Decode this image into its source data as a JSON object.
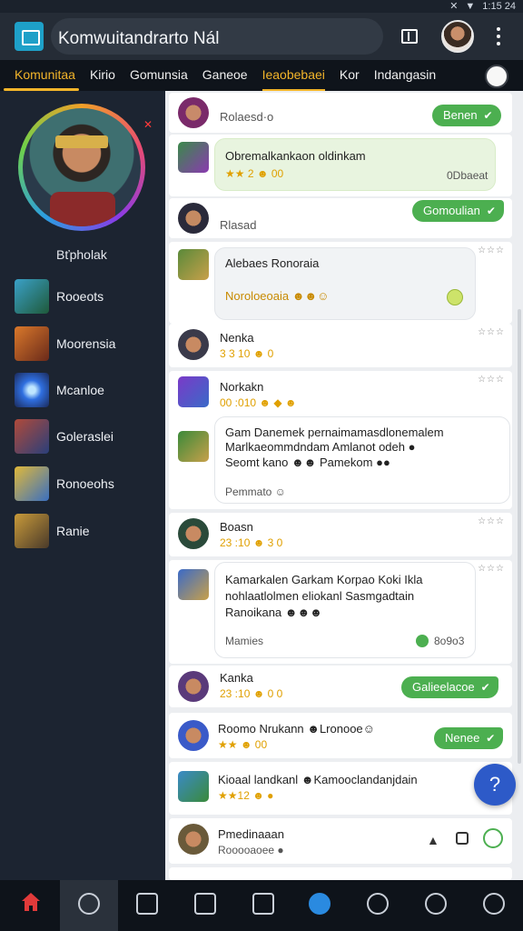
{
  "status_bar": {
    "time": "1:15 24"
  },
  "app_bar": {
    "title": "Komwuitandrarto Nál"
  },
  "tabs": [
    "Komunitaa",
    "Kirio",
    "Gomunsia",
    "Ganeoe",
    "Ieaobebaei",
    "Kor",
    "Indangasin"
  ],
  "sidebar": {
    "hero_name": "Bťpholak",
    "items": [
      {
        "label": "Rooeots",
        "color": "#3aa0c8"
      },
      {
        "label": "Moorensia",
        "color": "#d9782b"
      },
      {
        "label": "Mcanloe",
        "color": "#2f6fe0"
      },
      {
        "label": "Goleraslei",
        "color": "#b04a3a"
      },
      {
        "label": "Ronoeohs",
        "color": "#e0b83a"
      },
      {
        "label": "Ranie",
        "color": "#c89a3a"
      }
    ]
  },
  "feed": {
    "post1": {
      "name": "Rolaesd·o",
      "badge": "Benen"
    },
    "post2": {
      "text": "Obremalkankaon oldinkam",
      "meta": "★★ 2 ☻ 00",
      "right": "0Dbaeat"
    },
    "post3": {
      "name": "Rlasad",
      "badge": "Gomoulian"
    },
    "post4": {
      "title": "Alebaes Ronoraia",
      "sub": "Noroloeoaia ☻☻☺"
    },
    "post5": {
      "name": "Nenka",
      "meta": "3 3 10 ☻ 0"
    },
    "post6": {
      "name": "Norkakn",
      "meta": "00 :010 ☻ ◆ ☻",
      "line1": "Gam Danemek pernaimamasdlonemalem",
      "line2": "Marlkaeommdndam Amlanot odeh ●",
      "line3": "Seomt kano ☻☻ Pamekom ●●",
      "footer": "Pemmato ☺"
    },
    "post7": {
      "name": "Boasn",
      "meta": "23 :10 ☻ 3 0"
    },
    "post8": {
      "line1": "Kamarkalen Garkam Korpao Koki Ikla",
      "line2": "nohlaatlolmen eliokanl Sasmgadtain",
      "line3": "Ranoikana ☻☻☻",
      "footer": "Mamies",
      "count": "8o9o3"
    },
    "post9": {
      "name": "Kanka",
      "meta": "23 :10 ☻ 0 0",
      "badge": "Galieelacoe"
    },
    "post10": {
      "text": "Roomo Nrukann ☻Lronooe☺",
      "meta": "★★ ☻ 00",
      "badge": "Nenee"
    },
    "post11": {
      "text": "Kioaal landkanl ☻Kamooclandanjdain",
      "meta": "★★12 ☻ ●"
    },
    "post12": {
      "name": "Pmedinaaan",
      "sub": "Rooooaoee ●"
    }
  },
  "bottom_nav": [
    "home",
    "user",
    "house",
    "chat",
    "gallery",
    "bird",
    "target",
    "badge",
    "profile"
  ]
}
